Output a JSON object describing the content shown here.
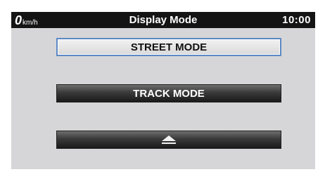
{
  "status_bar": {
    "speed_value": "0",
    "speed_unit": "km/h",
    "title": "Display Mode",
    "clock": "10:00"
  },
  "menu": {
    "items": [
      {
        "label": "STREET MODE",
        "selected": true
      },
      {
        "label": "TRACK MODE",
        "selected": false
      }
    ],
    "eject_icon": "eject-icon"
  },
  "colors": {
    "status_bar": "#141414",
    "screen_background": "#d6d6d8",
    "selection_border": "#5c89c4"
  }
}
